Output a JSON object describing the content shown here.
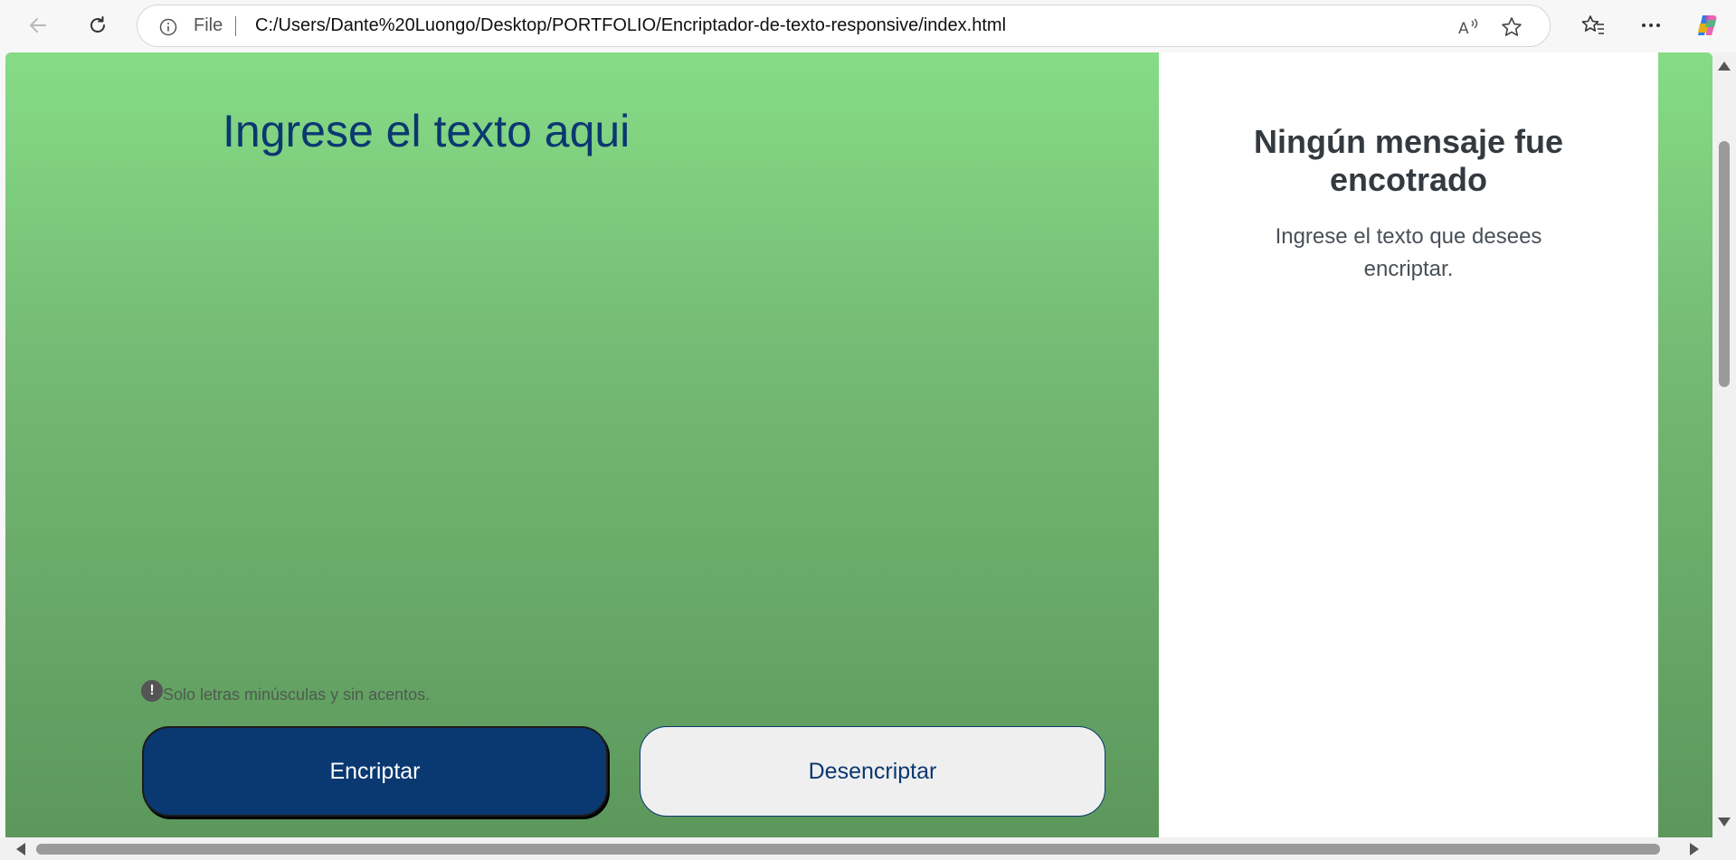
{
  "browser": {
    "address": {
      "scheme_label": "File",
      "url": "C:/Users/Dante%20Luongo/Desktop/PORTFOLIO/Encriptador-de-texto-responsive/index.html"
    },
    "icons": {
      "back": "back-arrow-icon",
      "refresh": "refresh-icon",
      "info": "info-icon",
      "read_aloud": "read-aloud-icon",
      "favorite": "star-icon",
      "favorites": "favorites-icon",
      "more": "more-icon",
      "copilot": "copilot-icon"
    }
  },
  "page": {
    "input_placeholder": "Ingrese el texto aqui",
    "hint_icon": "!",
    "hint_text": "Solo letras minúsculas y sin acentos.",
    "encrypt_label": "Encriptar",
    "decrypt_label": "Desencriptar",
    "output_title": "Ningún mensaje fue encotrado",
    "output_body": "Ingrese el texto que desees encriptar."
  },
  "colors": {
    "primary": "#0a3871",
    "gradient_top": "#86dc86",
    "gradient_bottom": "#5c975c",
    "panel": "#ffffff"
  }
}
